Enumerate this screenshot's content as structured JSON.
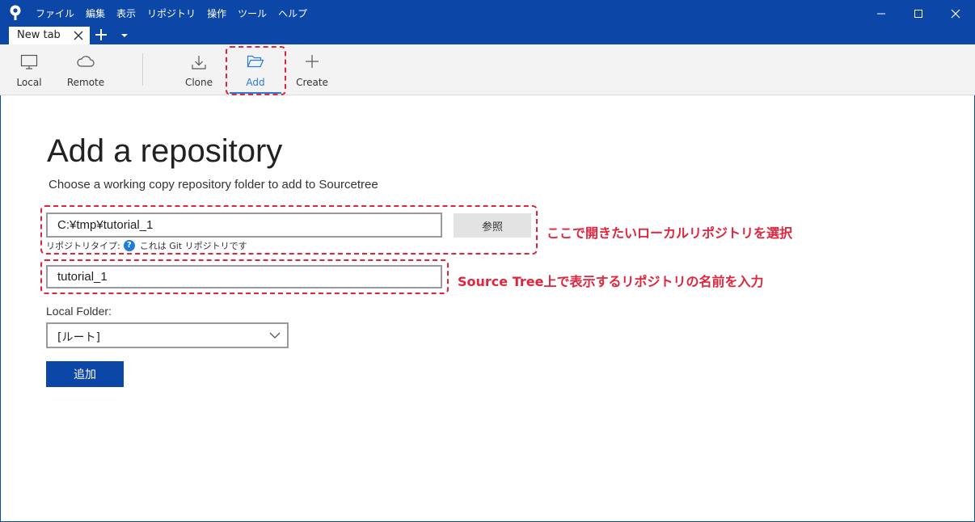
{
  "menu": [
    "ファイル",
    "編集",
    "表示",
    "リポジトリ",
    "操作",
    "ツール",
    "ヘルプ"
  ],
  "tab": {
    "label": "New tab"
  },
  "toolbar": {
    "local": "Local",
    "remote": "Remote",
    "clone": "Clone",
    "add": "Add",
    "create": "Create"
  },
  "page": {
    "title": "Add a repository",
    "subtitle": "Choose a working copy repository folder to add to Sourcetree"
  },
  "form": {
    "path_value": "C:¥tmp¥tutorial_1",
    "browse_label": "参照",
    "repo_type_label": "リポジトリタイプ:",
    "repo_type_value": "これは Git リポジトリです",
    "name_value": "tutorial_1",
    "local_folder_label": "Local Folder:",
    "local_folder_value": "[ルート]",
    "submit_label": "追加"
  },
  "annotations": {
    "select_repo": "ここで開きたいローカルリポジトリを選択",
    "name_repo": "Source Tree上で表示するリポジトリの名前を入力"
  },
  "colors": {
    "brand": "#0c47a7",
    "accent": "#2a7bd4",
    "annotation": "#e2233c"
  }
}
